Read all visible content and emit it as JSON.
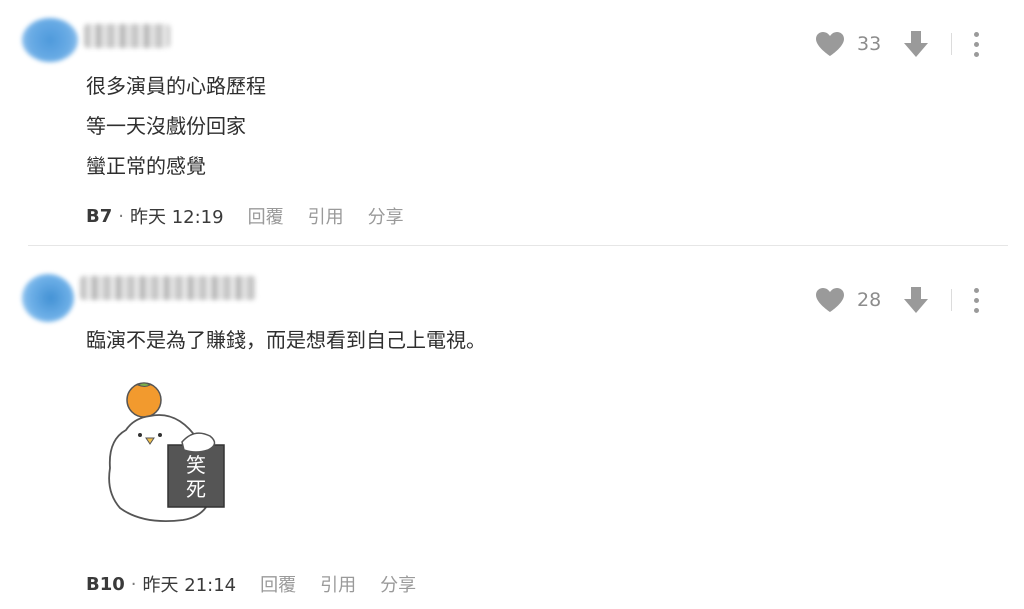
{
  "comments": [
    {
      "lines": [
        "很多演員的心路歷程",
        "等一天沒戲份回家",
        "蠻正常的感覺"
      ],
      "likes": "33",
      "floor": "B7",
      "time": "昨天 12:19",
      "reply_label": "回覆",
      "quote_label": "引用",
      "share_label": "分享"
    },
    {
      "lines": [
        "臨演不是為了賺錢，而是想看到自己上電視。"
      ],
      "likes": "28",
      "floor": "B10",
      "time": "昨天 21:14",
      "reply_label": "回覆",
      "quote_label": "引用",
      "share_label": "分享",
      "sticker": {
        "text_line1": "笑",
        "text_line2": "死"
      }
    }
  ],
  "colors": {
    "icon_gray": "#9a9a9a",
    "text": "#2f2f2f",
    "avatar_blue": "#3b8fd8",
    "sticker_orange": "#f29a2e"
  },
  "icons": [
    "heart-icon",
    "downvote-arrow-icon",
    "more-vertical-icon"
  ]
}
